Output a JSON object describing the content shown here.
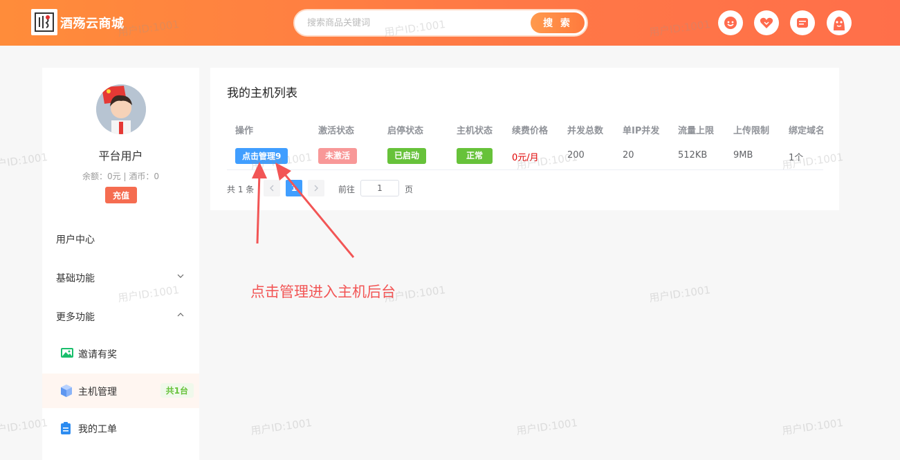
{
  "header": {
    "brand_name": "酒殇云商城",
    "search": {
      "placeholder": "搜索商品关键词",
      "button_label": "搜 索"
    },
    "icons": [
      "face-icon",
      "heart-badge-icon",
      "message-icon",
      "user-avatar-icon"
    ],
    "accent_color": "#ff7a45"
  },
  "sidebar": {
    "user": {
      "name": "平台用户",
      "balance_text": "余额：0元 | 酒币：0",
      "recharge_label": "充值"
    },
    "menu": [
      {
        "label": "用户中心"
      },
      {
        "label": "基础功能"
      },
      {
        "label": "更多功能"
      }
    ],
    "sub_items": [
      {
        "label": "邀请有奖",
        "icon": "image-icon"
      },
      {
        "label": "主机管理",
        "icon": "cube-icon",
        "badge": "共1台"
      },
      {
        "label": "我的工单",
        "icon": "clipboard-icon"
      }
    ]
  },
  "panel": {
    "title": "我的主机列表",
    "columns": [
      "操作",
      "激活状态",
      "启停状态",
      "主机状态",
      "续费价格",
      "并发总数",
      "单IP并发",
      "流量上限",
      "上传限制",
      "绑定域名"
    ],
    "rows": [
      {
        "action": "点击管理9",
        "activation": "未激活",
        "run_state": "已启动",
        "host_state": "正常",
        "price": "0元/月",
        "concurrency": "200",
        "per_ip": "20",
        "traffic": "512KB",
        "upload": "9MB",
        "domains": "1个"
      }
    ],
    "pagination": {
      "total_text": "共 1 条",
      "current_page": "1",
      "goto_label": "前往",
      "goto_value": "1",
      "page_unit": "页"
    }
  },
  "annotation": {
    "text": "点击管理进入主机后台",
    "color": "#f25555"
  },
  "watermark": {
    "text": "用户ID:1001"
  }
}
